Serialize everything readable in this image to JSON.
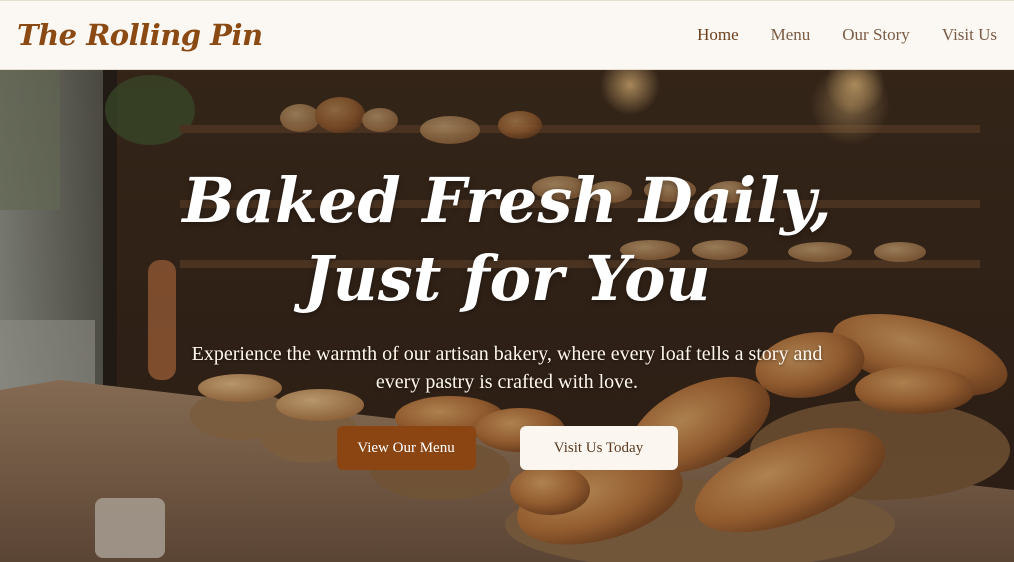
{
  "brand": {
    "name": "The Rolling Pin"
  },
  "nav": {
    "items": [
      {
        "label": "Home",
        "active": true
      },
      {
        "label": "Menu"
      },
      {
        "label": "Our Story"
      },
      {
        "label": "Visit Us"
      }
    ]
  },
  "hero": {
    "title": "Baked Fresh Daily, Just for You",
    "subtitle": "Experience the warmth of our artisan bakery, where every loaf tells a story and every pastry is crafted with love.",
    "primary_button": "View Our Menu",
    "secondary_button": "Visit Us Today"
  },
  "colors": {
    "brand": "#8b4a14",
    "primary_button": "#8b4513",
    "background": "#fbf8f3"
  }
}
